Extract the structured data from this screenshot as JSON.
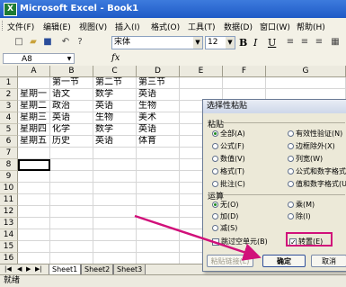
{
  "window": {
    "title": "Microsoft Excel - Book1",
    "app_icon": "X"
  },
  "menubar": {
    "items": [
      "文件(F)",
      "编辑(E)",
      "视图(V)",
      "插入(I)",
      "格式(O)",
      "工具(T)",
      "数据(D)",
      "窗口(W)",
      "帮助(H)"
    ]
  },
  "toolbar": {
    "font_name": "宋体",
    "font_size": "12",
    "bold": "B",
    "italic": "I",
    "underline": "U"
  },
  "formula_bar": {
    "name_box": "A8",
    "fx": "fx",
    "content": ""
  },
  "grid": {
    "columns": [
      "A",
      "B",
      "C",
      "D",
      "E",
      "F",
      "G"
    ],
    "rows": [
      "1",
      "2",
      "3",
      "4",
      "5",
      "6",
      "7",
      "8",
      "9",
      "10",
      "11",
      "12",
      "13",
      "14",
      "15",
      "16"
    ],
    "cells": [
      [
        "",
        "第一节",
        "第二节",
        "第三节"
      ],
      [
        "星期一",
        "语文",
        "数学",
        "英语"
      ],
      [
        "星期二",
        "政治",
        "英语",
        "生物"
      ],
      [
        "星期三",
        "英语",
        "生物",
        "美术"
      ],
      [
        "星期四",
        "化学",
        "数学",
        "英语"
      ],
      [
        "星期五",
        "历史",
        "英语",
        "体育"
      ]
    ]
  },
  "sheets": {
    "tabs": [
      "Sheet1",
      "Sheet2",
      "Sheet3"
    ],
    "active": "Sheet1"
  },
  "status": {
    "text": "就绪"
  },
  "dialog": {
    "title": "选择性粘贴",
    "paste_label": "粘贴",
    "paste_options_left": [
      "全部(A)",
      "公式(F)",
      "数值(V)",
      "格式(T)",
      "批注(C)"
    ],
    "paste_options_right": [
      "有效性验证(N)",
      "边框除外(X)",
      "列宽(W)",
      "公式和数字格式(R)",
      "值和数字格式(U)"
    ],
    "paste_selected": "全部(A)",
    "operation_label": "运算",
    "operation_left": [
      "无(O)",
      "加(D)",
      "减(S)"
    ],
    "operation_right": [
      "乘(M)",
      "除(I)"
    ],
    "operation_selected": "无(O)",
    "skip_blanks": "跳过空单元(B)",
    "transpose": "转置(E)",
    "transpose_checked": true,
    "paste_link_button": "粘贴链接(L)",
    "ok_button": "确定",
    "cancel_button": "取消"
  },
  "colors": {
    "highlight": "#d1107a",
    "title_bar": "#1f5ac6"
  }
}
